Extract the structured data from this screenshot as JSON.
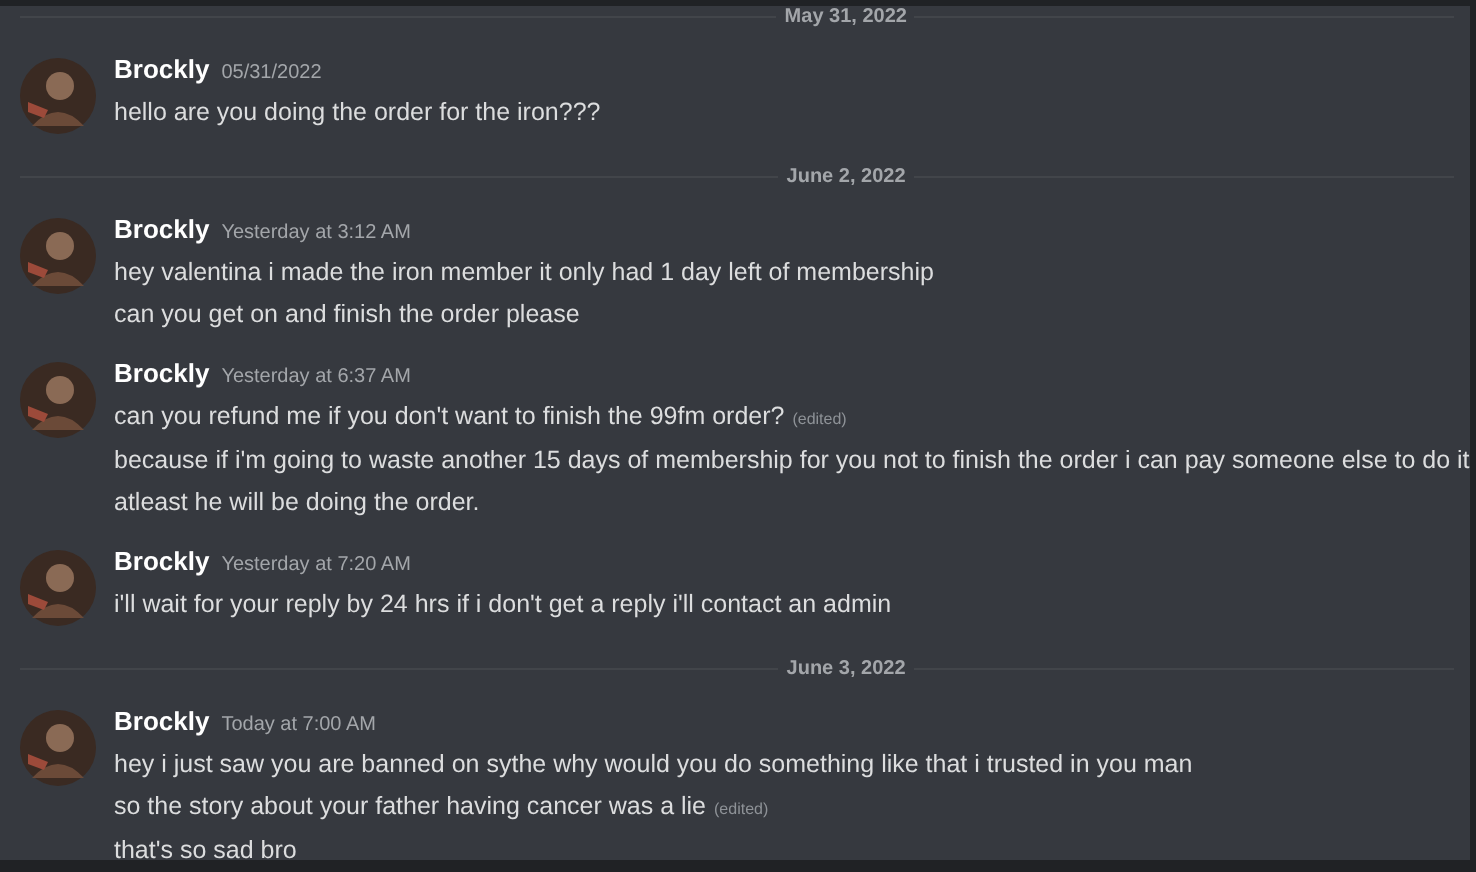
{
  "feed": [
    {
      "kind": "divider",
      "label": "May 31, 2022"
    },
    {
      "kind": "message",
      "author": "Brockly",
      "timestamp": "05/31/2022",
      "lines": [
        {
          "text": "hello are you doing the order for the iron???"
        }
      ]
    },
    {
      "kind": "divider",
      "label": "June 2, 2022"
    },
    {
      "kind": "message",
      "author": "Brockly",
      "timestamp": "Yesterday at 3:12 AM",
      "lines": [
        {
          "text": "hey valentina  i made the iron member it only had 1 day left of membership"
        },
        {
          "text": "can you get on and finish the order please"
        }
      ]
    },
    {
      "kind": "message",
      "author": "Brockly",
      "timestamp": "Yesterday at 6:37 AM",
      "lines": [
        {
          "text": "can you refund me if you don't want to finish the 99fm order?",
          "edited": "(edited)"
        },
        {
          "text": "because if i'm going to waste another 15 days of membership for you not to finish the order i can pay someone else to do it"
        },
        {
          "text": "atleast he will be doing the order."
        }
      ]
    },
    {
      "kind": "message",
      "author": "Brockly",
      "timestamp": "Yesterday at 7:20 AM",
      "lines": [
        {
          "text": "i'll wait for your reply by 24 hrs if i don't get a reply i'll contact an admin"
        }
      ]
    },
    {
      "kind": "divider",
      "label": "June 3, 2022"
    },
    {
      "kind": "message",
      "author": "Brockly",
      "timestamp": "Today at 7:00 AM",
      "lines": [
        {
          "text": "hey i just saw you are banned on sythe why would you do something like that i trusted in you man"
        },
        {
          "text": "so the story about your father having cancer was a lie",
          "edited": "(edited)"
        },
        {
          "text": "that's so sad bro"
        }
      ]
    }
  ]
}
